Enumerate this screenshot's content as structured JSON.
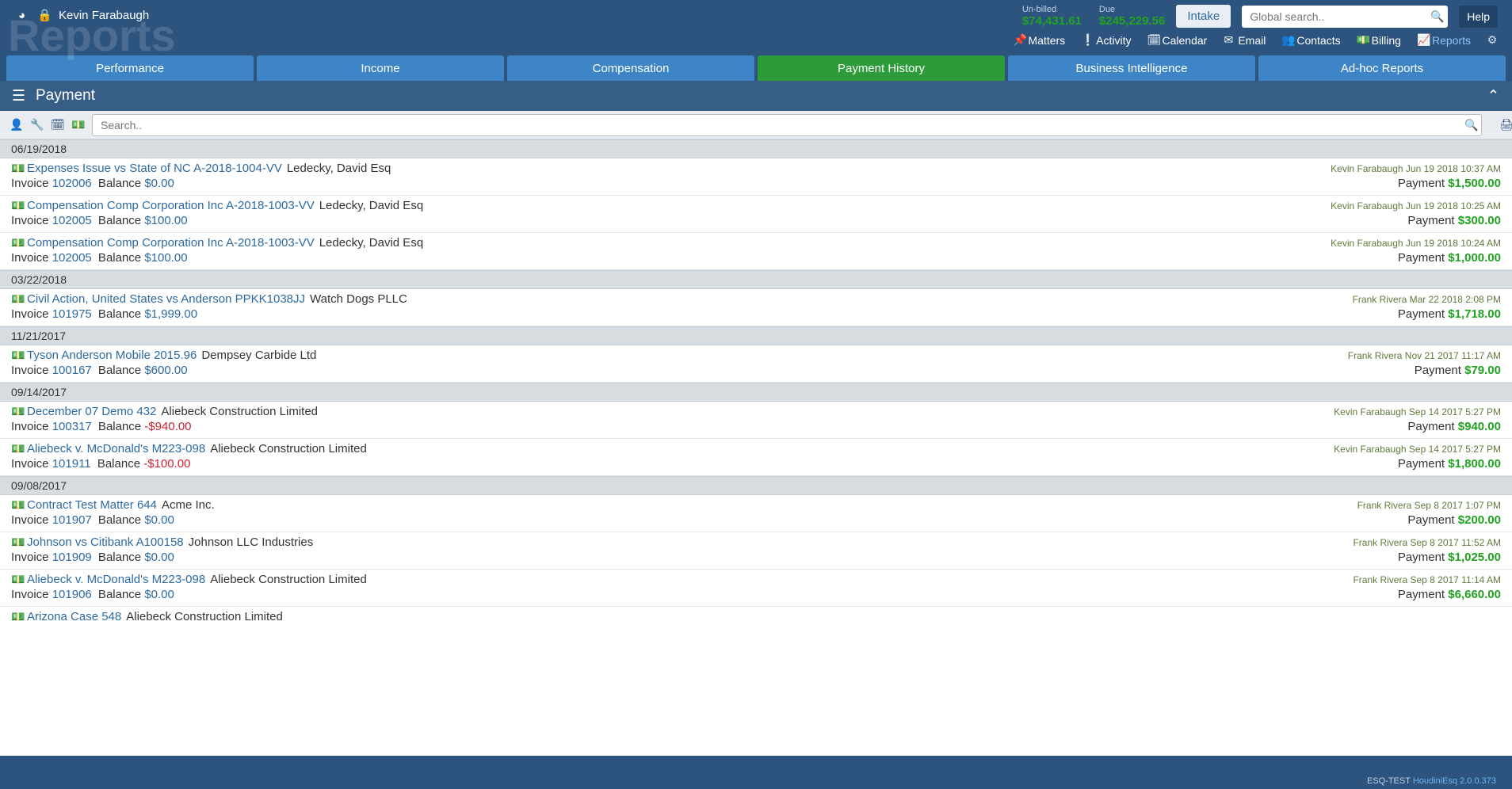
{
  "user_name": "Kevin Farabaugh",
  "watermark": "Reports",
  "billing": {
    "unbilled_label": "Un-billed",
    "unbilled_value": "$74,431.61",
    "due_label": "Due",
    "due_value": "$245,229.56"
  },
  "intake_label": "Intake",
  "global_search_placeholder": "Global search..",
  "help_label": "Help",
  "nav": {
    "matters": "Matters",
    "activity": "Activity",
    "calendar": "Calendar",
    "email": "Email",
    "contacts": "Contacts",
    "billing": "Billing",
    "reports": "Reports"
  },
  "tabs": [
    {
      "label": "Performance",
      "active": false
    },
    {
      "label": "Income",
      "active": false
    },
    {
      "label": "Compensation",
      "active": false
    },
    {
      "label": "Payment History",
      "active": true
    },
    {
      "label": "Business Intelligence",
      "active": false
    },
    {
      "label": "Ad-hoc Reports",
      "active": false
    }
  ],
  "section_title": "Payment",
  "filter_search_placeholder": "Search..",
  "invoice_word": "Invoice",
  "balance_word": "Balance",
  "payment_word": "Payment",
  "groups": [
    {
      "date": "06/19/2018",
      "entries": [
        {
          "matter": "Expenses Issue vs State of NC A-2018-1004-VV",
          "party": "Ledecky, David Esq",
          "author": "Kevin Farabaugh",
          "timestamp": "Jun 19 2018 10:37 AM",
          "invoice": "102006",
          "balance": "$0.00",
          "balance_negative": false,
          "payment": "$1,500.00"
        },
        {
          "matter": "Compensation Comp Corporation Inc A-2018-1003-VV",
          "party": "Ledecky, David Esq",
          "author": "Kevin Farabaugh",
          "timestamp": "Jun 19 2018 10:25 AM",
          "invoice": "102005",
          "balance": "$100.00",
          "balance_negative": false,
          "payment": "$300.00"
        },
        {
          "matter": "Compensation Comp Corporation Inc A-2018-1003-VV",
          "party": "Ledecky, David Esq",
          "author": "Kevin Farabaugh",
          "timestamp": "Jun 19 2018 10:24 AM",
          "invoice": "102005",
          "balance": "$100.00",
          "balance_negative": false,
          "payment": "$1,000.00"
        }
      ]
    },
    {
      "date": "03/22/2018",
      "entries": [
        {
          "matter": "Civil Action, United States vs Anderson PPKK1038JJ",
          "party": "Watch Dogs PLLC",
          "author": "Frank Rivera",
          "timestamp": "Mar 22 2018 2:08 PM",
          "invoice": "101975",
          "balance": "$1,999.00",
          "balance_negative": false,
          "payment": "$1,718.00"
        }
      ]
    },
    {
      "date": "11/21/2017",
      "entries": [
        {
          "matter": "Tyson Anderson Mobile 2015.96",
          "party": "Dempsey Carbide Ltd",
          "author": "Frank Rivera",
          "timestamp": "Nov 21 2017 11:17 AM",
          "invoice": "100167",
          "balance": "$600.00",
          "balance_negative": false,
          "payment": "$79.00"
        }
      ]
    },
    {
      "date": "09/14/2017",
      "entries": [
        {
          "matter": "December 07 Demo 432",
          "party": "Aliebeck Construction Limited",
          "author": "Kevin Farabaugh",
          "timestamp": "Sep 14 2017 5:27 PM",
          "invoice": "100317",
          "balance": "-$940.00",
          "balance_negative": true,
          "payment": "$940.00"
        },
        {
          "matter": "Aliebeck v. McDonald's M223-098",
          "party": "Aliebeck Construction Limited",
          "author": "Kevin Farabaugh",
          "timestamp": "Sep 14 2017 5:27 PM",
          "invoice": "101911",
          "balance": "-$100.00",
          "balance_negative": true,
          "payment": "$1,800.00"
        }
      ]
    },
    {
      "date": "09/08/2017",
      "entries": [
        {
          "matter": "Contract Test Matter 644",
          "party": "Acme Inc.",
          "author": "Frank Rivera",
          "timestamp": "Sep 8 2017 1:07 PM",
          "invoice": "101907",
          "balance": "$0.00",
          "balance_negative": false,
          "payment": "$200.00"
        },
        {
          "matter": "Johnson vs Citibank A100158",
          "party": "Johnson LLC Industries",
          "author": "Frank Rivera",
          "timestamp": "Sep 8 2017 11:52 AM",
          "invoice": "101909",
          "balance": "$0.00",
          "balance_negative": false,
          "payment": "$1,025.00"
        },
        {
          "matter": "Aliebeck v. McDonald's M223-098",
          "party": "Aliebeck Construction Limited",
          "author": "Frank Rivera",
          "timestamp": "Sep 8 2017 11:14 AM",
          "invoice": "101906",
          "balance": "$0.00",
          "balance_negative": false,
          "payment": "$6,660.00"
        }
      ],
      "truncated_entry": {
        "matter": "Arizona Case 548",
        "party": "Aliebeck Construction Limited"
      }
    }
  ],
  "footer": {
    "env": "ESQ-TEST",
    "product": "HoudiniEsq 2.0.0.373"
  }
}
